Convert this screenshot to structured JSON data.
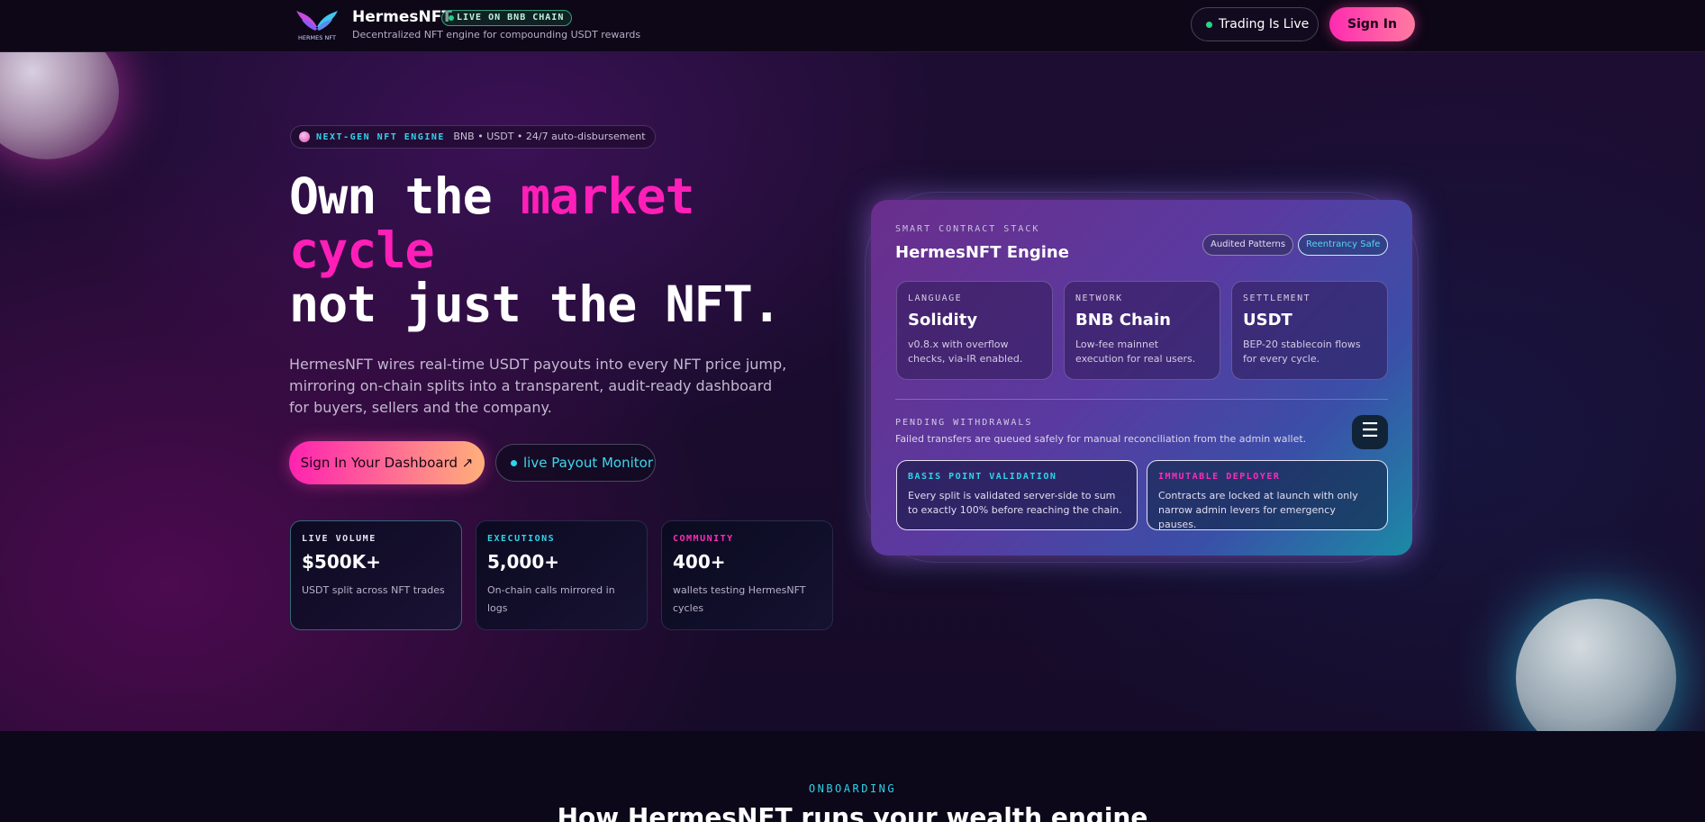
{
  "header": {
    "brand_name": "HermesNFT",
    "live_pill": "LIVE ON BNB CHAIN",
    "tagline": "Decentralized NFT engine for compounding USDT rewards",
    "trading_label": "Trading Is Live",
    "signin_label": "Sign In",
    "logo_text": "HERMES NFT"
  },
  "hero": {
    "pill_key": "NEXT-GEN NFT ENGINE",
    "pill_value": "BNB • USDT • 24/7 auto-disbursement",
    "headline_1": "Own the ",
    "headline_pink": "market cycle",
    "headline_2": "not just the NFT.",
    "subcopy": "HermesNFT wires real-time USDT payouts into every NFT price jump, mirroring on-chain splits into a transparent, audit-ready dashboard for buyers, sellers and the company.",
    "cta_primary": "Sign In Your Dashboard ↗",
    "cta_secondary": "live Payout Monitor"
  },
  "stats": [
    {
      "label": "LIVE VOLUME",
      "value": "$500K+",
      "desc": "USDT split across NFT trades",
      "color": "#e9e4f2"
    },
    {
      "label": "EXECUTIONS",
      "value": "5,000+",
      "desc": "On-chain calls mirrored in logs",
      "color": "#2fd4e8"
    },
    {
      "label": "COMMUNITY",
      "value": "400+",
      "desc": "wallets testing HermesNFT cycles",
      "color": "#ff2bb8"
    }
  ],
  "card": {
    "kicker": "SMART CONTRACT STACK",
    "title": "HermesNFT Engine",
    "chip_a": "Audited Patterns",
    "chip_b": "Reentrancy Safe",
    "tiles": [
      {
        "label": "LANGUAGE",
        "value": "Solidity",
        "desc": "v0.8.x with overflow checks, via-IR enabled."
      },
      {
        "label": "NETWORK",
        "value": "BNB Chain",
        "desc": "Low-fee mainnet execution for real users."
      },
      {
        "label": "SETTLEMENT",
        "value": "USDT",
        "desc": "BEP-20 stablecoin flows for every cycle."
      }
    ],
    "pending_kicker": "PENDING WITHDRAWALS",
    "pending_desc": "Failed transfers are queued safely for manual reconciliation from the admin wallet.",
    "menu_icon": "☰",
    "boxes": [
      {
        "label": "BASIS POINT VALIDATION",
        "desc": "Every split is validated server-side to sum to exactly 100% before reaching the chain.",
        "color": "#2fd4e8"
      },
      {
        "label": "IMMUTABLE DEPLOYER",
        "desc": "Contracts are locked at launch with only narrow admin levers for emergency pauses.",
        "color": "#ff2bb8"
      }
    ]
  },
  "section": {
    "kicker": "ONBOARDING",
    "title": "How HermesNFT runs your wealth engine"
  }
}
